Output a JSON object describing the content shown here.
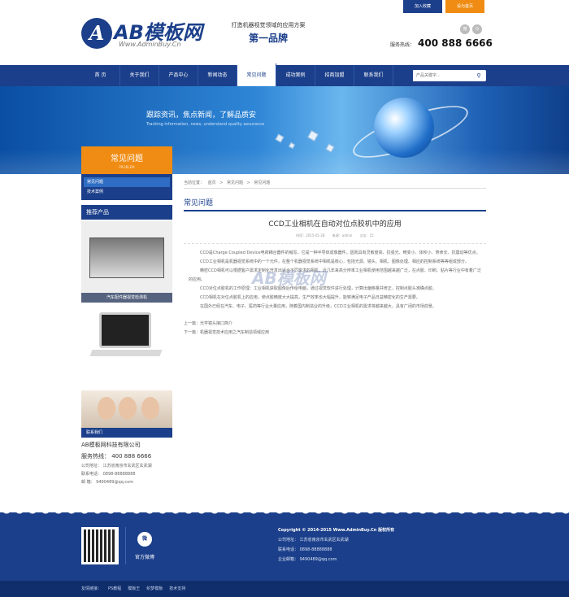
{
  "topbar": {
    "favorite": "加入收藏",
    "home": "设为首页"
  },
  "logo": {
    "name": "AB模板网",
    "url": "Www.AdminBuy.Cn",
    "mark": "A"
  },
  "slogan": {
    "line1": "打造机器视觉领域的应用方案",
    "line2": "第一品牌"
  },
  "social": [
    "微",
    "Q"
  ],
  "hotline": {
    "label": "服务热线：",
    "number": "400 888 6666"
  },
  "nav": {
    "items": [
      "首 页",
      "关于我们",
      "产品中心",
      "新闻动态",
      "常见问题",
      "成功案例",
      "招商加盟",
      "联系我们"
    ],
    "active_index": 4
  },
  "search": {
    "placeholder": "产品关键字...",
    "icon": "search-icon"
  },
  "banner": {
    "title": "跟踪资讯，焦点新闻，了解品质安",
    "subtitle": "Tracking information, news, understand quality assurance"
  },
  "sidebar": {
    "title": "常见问题",
    "subtitle": "PROBLEM",
    "menu": [
      "常见问题",
      "技术案例"
    ],
    "recommend_title": "推荐产品",
    "products": [
      {
        "caption": "汽车配件器视觉检测机"
      },
      {
        "caption": ""
      }
    ],
    "contact_caption": "联系我们",
    "company": "AB模板网科技有限公司",
    "phone_line": "服务热线：  400 888 6666",
    "lines": [
      "公司地址：  江苏省南京市玄武区玄武湖",
      "联系电话：  0898-88888888",
      "邮    箱：  9490489@qq.com"
    ]
  },
  "main": {
    "breadcrumb": [
      "当前位置：",
      "首页",
      ">",
      "常见问题",
      ">",
      "常见问题"
    ],
    "section_title": "常见问题",
    "article_title": "CCD工业相机在自动对位点胶机中的应用",
    "meta": [
      "时间：2015-01-28",
      "来源：admin",
      "点击：15"
    ],
    "paragraphs": [
      "CCD是Charge Coupled Device电荷耦合器件的缩写，它是一种半导体成像器件，因而具有灵敏度高、抗强光、畸变小、体积小、寿命长、抗震动等优点。",
      "CCD工业相机是机器视觉系统中的一个元件，在整个机器视觉系统中相机是核心，包括光源、镜头、相机、图像处理、相应的控制系统等等组成部分。",
      "精密CCD相机可以根据客户需求定制化开发出适合不同需求的相机，近几年来高分辨率工业相机使用范围越来越广泛，在点胶、印刷、贴片等行业中有着广泛的应用。",
      "CCD对位点胶机的工作原理：工业相机获取图像后传给电脑，通过视觉软件进行处理，计算出偏移量并修正，控制点胶头准确点胶。",
      "CCD相机在对位点胶机上的应用，使点胶精度大大提高，生产效率也大幅提升，能够满足电子产品日益精密化的生产需要。",
      "在国外已经在汽车、电子、医药等行业大量应用，随着国内制造业的升级，CCD工业相机的需求将越来越大，具有广阔的市场前景。"
    ],
    "prev": "上一篇：光学镜头接口简介",
    "next": "下一篇：机器视觉技术应用之汽车制造领域应用"
  },
  "watermark": "AB模板网",
  "footer": {
    "weibo_icon": "微",
    "weibo_label": "官方微博",
    "copyright": "Copyright © 2014-2015 Www.AdminBuy.Cn 版权所有",
    "lines": [
      "公司地址：  江苏省南京市玄武区玄武湖",
      "联系电话：  0898-88888888",
      "企业邮箱：  9490489@qq.com"
    ],
    "links": [
      "友情链接：",
      "PS教程",
      "模板王",
      "织梦模板",
      "技术支持"
    ]
  },
  "colors": {
    "primary": "#1b3f8a",
    "accent": "#f08c13"
  }
}
